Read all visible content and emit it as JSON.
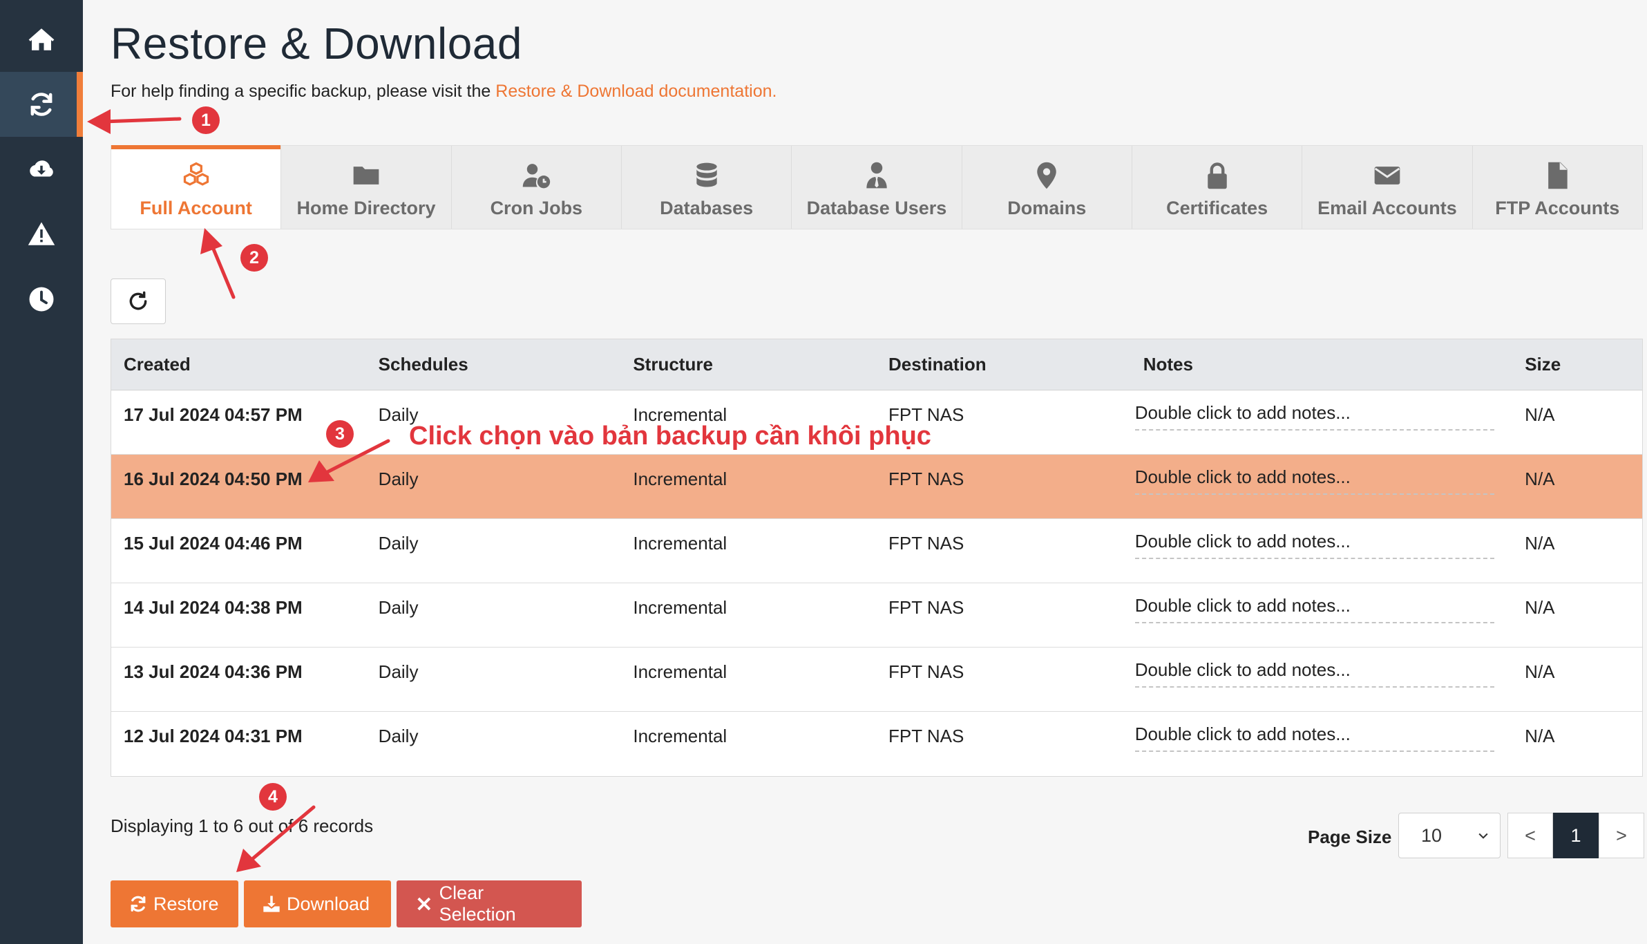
{
  "header": {
    "title": "Restore & Download",
    "help_prefix": "For help finding a specific backup, please visit the",
    "help_link": "Restore & Download documentation."
  },
  "sidebar": {
    "items": [
      {
        "icon": "home-icon"
      },
      {
        "icon": "sync-icon",
        "active": true
      },
      {
        "icon": "cloud-download-icon"
      },
      {
        "icon": "warning-icon"
      },
      {
        "icon": "clock-icon"
      }
    ]
  },
  "tabs": [
    {
      "label": "Full Account",
      "icon": "cubes-icon",
      "active": true
    },
    {
      "label": "Home Directory",
      "icon": "folder-icon"
    },
    {
      "label": "Cron Jobs",
      "icon": "user-clock-icon"
    },
    {
      "label": "Databases",
      "icon": "database-icon"
    },
    {
      "label": "Database Users",
      "icon": "user-tie-icon"
    },
    {
      "label": "Domains",
      "icon": "map-marker-icon"
    },
    {
      "label": "Certificates",
      "icon": "lock-icon"
    },
    {
      "label": "Email Accounts",
      "icon": "envelope-icon"
    },
    {
      "label": "FTP Accounts",
      "icon": "file-icon"
    }
  ],
  "table": {
    "columns": [
      "Created",
      "Schedules",
      "Structure",
      "Destination",
      "Notes",
      "Size"
    ],
    "rows": [
      {
        "created": "17 Jul 2024 04:57 PM",
        "schedule": "Daily",
        "structure": "Incremental",
        "destination": "FPT NAS",
        "notes": "Double click to add notes...",
        "size": "N/A"
      },
      {
        "created": "16 Jul 2024 04:50 PM",
        "schedule": "Daily",
        "structure": "Incremental",
        "destination": "FPT NAS",
        "notes": "Double click to add notes...",
        "size": "N/A",
        "selected": true
      },
      {
        "created": "15 Jul 2024 04:46 PM",
        "schedule": "Daily",
        "structure": "Incremental",
        "destination": "FPT NAS",
        "notes": "Double click to add notes...",
        "size": "N/A"
      },
      {
        "created": "14 Jul 2024 04:38 PM",
        "schedule": "Daily",
        "structure": "Incremental",
        "destination": "FPT NAS",
        "notes": "Double click to add notes...",
        "size": "N/A"
      },
      {
        "created": "13 Jul 2024 04:36 PM",
        "schedule": "Daily",
        "structure": "Incremental",
        "destination": "FPT NAS",
        "notes": "Double click to add notes...",
        "size": "N/A"
      },
      {
        "created": "12 Jul 2024 04:31 PM",
        "schedule": "Daily",
        "structure": "Incremental",
        "destination": "FPT NAS",
        "notes": "Double click to add notes...",
        "size": "N/A"
      }
    ]
  },
  "footer": {
    "records_text": "Displaying 1 to 6 out of 6 records",
    "page_size_label": "Page Size",
    "page_size_value": "10",
    "prev": "<",
    "current_page": "1",
    "next": ">"
  },
  "actions": {
    "restore": "Restore",
    "download": "Download",
    "clear": "Clear Selection"
  },
  "annotations": {
    "step1": "1",
    "step2": "2",
    "step3": "3",
    "step4": "4",
    "instruction": "Click chọn vào bản backup cần khôi phục"
  },
  "colors": {
    "accent": "#ee7634",
    "sidebar": "#263340",
    "selected_row": "#f3ae8a",
    "clear_button": "#d35650",
    "annotation": "#e2363d"
  }
}
